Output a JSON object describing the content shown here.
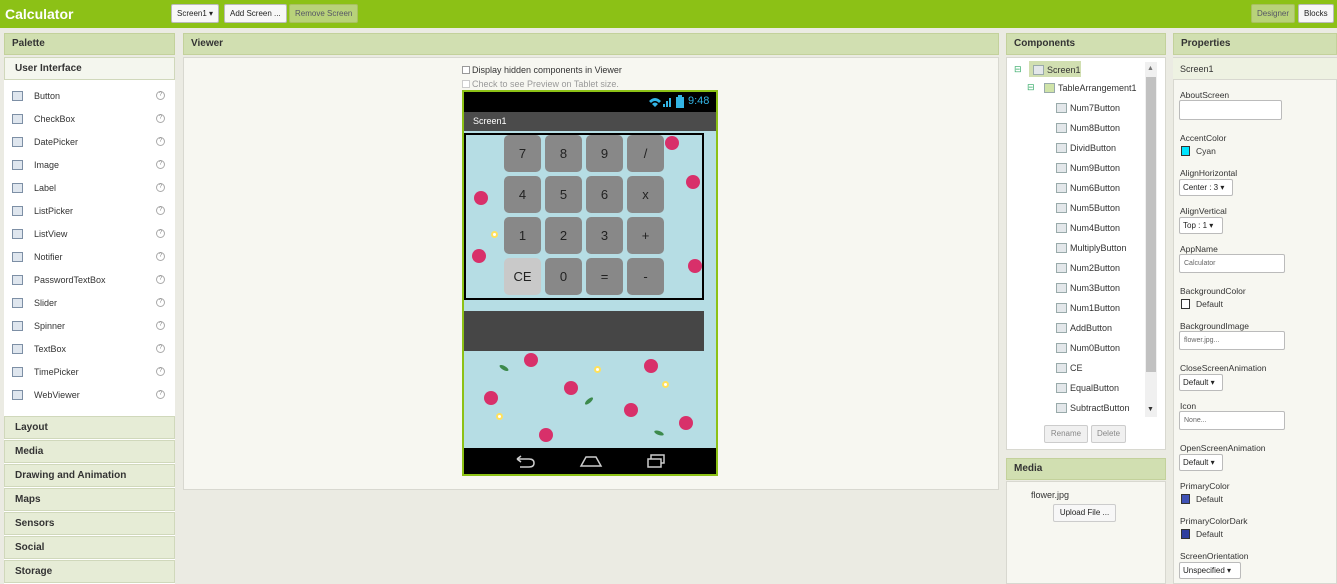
{
  "app": {
    "title": "Calculator"
  },
  "toolbar": {
    "screen_select": "Screen1 ▾",
    "add_screen": "Add Screen ...",
    "remove_screen": "Remove Screen",
    "designer": "Designer",
    "blocks": "Blocks"
  },
  "palette": {
    "header": "Palette",
    "category_user_interface": "User Interface",
    "items": [
      {
        "label": "Button",
        "icon": "button-icon"
      },
      {
        "label": "CheckBox",
        "icon": "checkbox-icon"
      },
      {
        "label": "DatePicker",
        "icon": "datepicker-icon"
      },
      {
        "label": "Image",
        "icon": "image-icon"
      },
      {
        "label": "Label",
        "icon": "label-icon"
      },
      {
        "label": "ListPicker",
        "icon": "listpicker-icon"
      },
      {
        "label": "ListView",
        "icon": "listview-icon"
      },
      {
        "label": "Notifier",
        "icon": "notifier-icon"
      },
      {
        "label": "PasswordTextBox",
        "icon": "password-icon"
      },
      {
        "label": "Slider",
        "icon": "slider-icon"
      },
      {
        "label": "Spinner",
        "icon": "spinner-icon"
      },
      {
        "label": "TextBox",
        "icon": "textbox-icon"
      },
      {
        "label": "TimePicker",
        "icon": "timepicker-icon"
      },
      {
        "label": "WebViewer",
        "icon": "webviewer-icon"
      }
    ],
    "help_glyph": "?",
    "categories": [
      "Layout",
      "Media",
      "Drawing and Animation",
      "Maps",
      "Sensors",
      "Social",
      "Storage"
    ]
  },
  "viewer": {
    "header": "Viewer",
    "display_hidden": "Display hidden components in Viewer",
    "tablet_preview": "Check to see Preview on Tablet size.",
    "status_time": "9:48",
    "screen_title": "Screen1",
    "buttons": [
      "7",
      "8",
      "9",
      "/",
      "4",
      "5",
      "6",
      "x",
      "1",
      "2",
      "3",
      "+",
      "CE",
      "0",
      "=",
      "-"
    ]
  },
  "components": {
    "header": "Components",
    "root": "Screen1",
    "arrangement": "TableArrangement1",
    "children": [
      "Num7Button",
      "Num8Button",
      "DividButton",
      "Num9Button",
      "Num6Button",
      "Num5Button",
      "Num4Button",
      "MultiplyButton",
      "Num2Button",
      "Num3Button",
      "Num1Button",
      "AddButton",
      "Num0Button",
      "CE",
      "EqualButton",
      "SubtractButton"
    ],
    "rename": "Rename",
    "delete": "Delete",
    "collapse_glyph": "⊟"
  },
  "media": {
    "header": "Media",
    "file": "flower.jpg",
    "upload": "Upload File ..."
  },
  "properties": {
    "header": "Properties",
    "component": "Screen1",
    "about_screen": "AboutScreen",
    "accent_color": "AccentColor",
    "accent_color_value": "Cyan",
    "align_horizontal": "AlignHorizontal",
    "align_horizontal_value": "Center : 3 ▾",
    "align_vertical": "AlignVertical",
    "align_vertical_value": "Top : 1 ▾",
    "app_name": "AppName",
    "app_name_value": "Calculator",
    "background_color": "BackgroundColor",
    "background_color_value": "Default",
    "background_image": "BackgroundImage",
    "background_image_value": "flower.jpg...",
    "close_anim": "CloseScreenAnimation",
    "close_anim_value": "Default ▾",
    "icon": "Icon",
    "icon_value": "None...",
    "open_anim": "OpenScreenAnimation",
    "open_anim_value": "Default ▾",
    "primary_color": "PrimaryColor",
    "primary_color_value": "Default",
    "primary_color_dark": "PrimaryColorDark",
    "primary_color_dark_value": "Default",
    "screen_orientation": "ScreenOrientation",
    "screen_orientation_value": "Unspecified ▾"
  },
  "colors": {
    "brand_green": "#8cc116",
    "panel_header": "#d1dfb1",
    "accent_cyan": "#00e5ff",
    "primary_blue": "#3f51b5",
    "primary_dark_blue": "#303f9f"
  }
}
